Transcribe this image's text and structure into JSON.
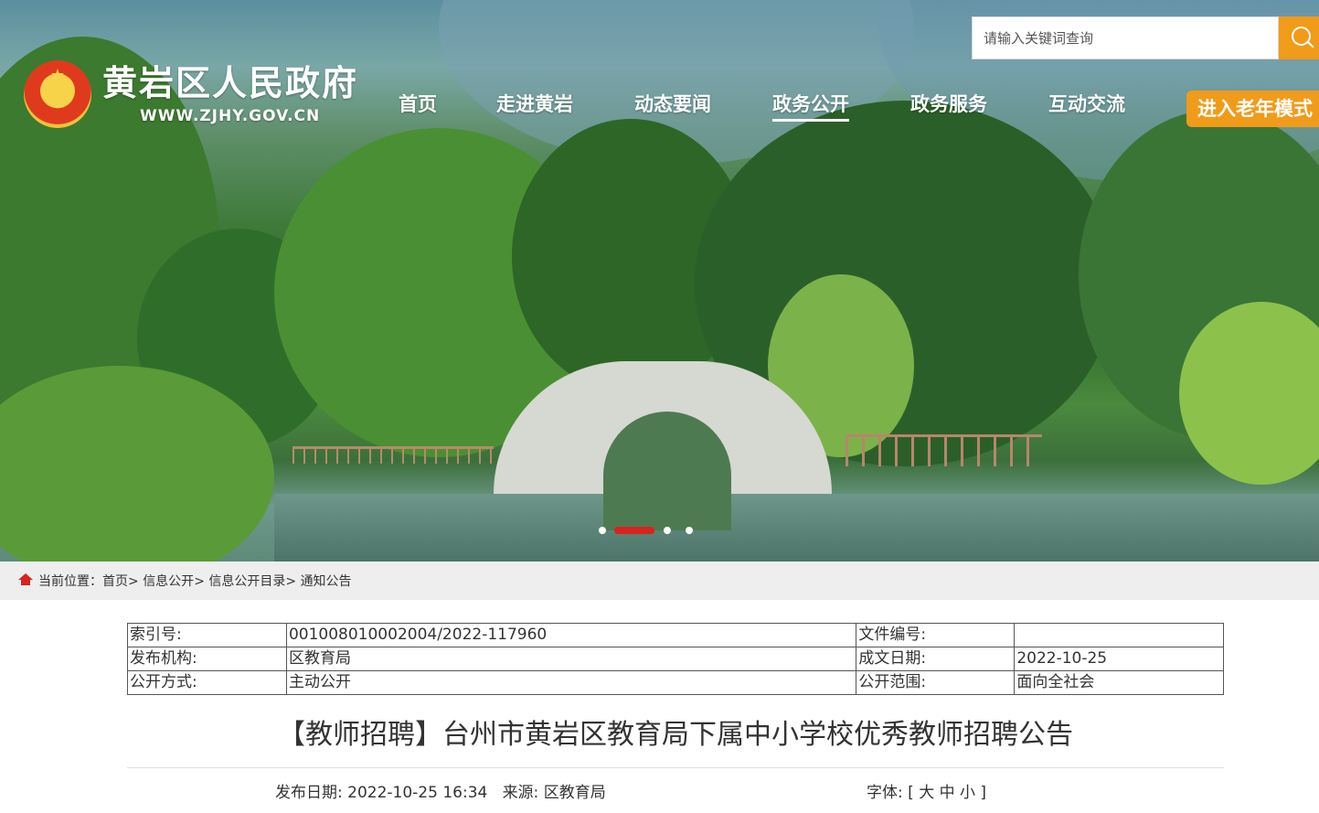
{
  "site": {
    "name": "黄岩区人民政府",
    "url": "WWW.ZJHY.GOV.CN"
  },
  "search": {
    "placeholder": "请输入关键词查询",
    "icon": "search-icon"
  },
  "nav": {
    "items": [
      {
        "label": "首页",
        "active": false
      },
      {
        "label": "走进黄岩",
        "active": false
      },
      {
        "label": "动态要闻",
        "active": false
      },
      {
        "label": "政务公开",
        "active": true
      },
      {
        "label": "政务服务",
        "active": false
      },
      {
        "label": "互动交流",
        "active": false
      }
    ],
    "elder_mode_label": "进入老年模式"
  },
  "slider": {
    "slide_count": 4,
    "active_index": 1
  },
  "breadcrumb": {
    "prefix": "当前位置：",
    "items": [
      "首页",
      "信息公开",
      "信息公开目录",
      "通知公告"
    ],
    "separator": ">"
  },
  "meta": {
    "rows": [
      {
        "k1": "索引号:",
        "v1": "001008010002004/2022-117960",
        "k2": "文件编号:",
        "v2": ""
      },
      {
        "k1": "发布机构:",
        "v1": "区教育局",
        "k2": "成文日期:",
        "v2": "2022-10-25"
      },
      {
        "k1": "公开方式:",
        "v1": "主动公开",
        "k2": "公开范围:",
        "v2": "面向全社会"
      }
    ]
  },
  "article": {
    "title": "【教师招聘】台州市黄岩区教育局下属中小学校优秀教师招聘公告",
    "publish_label": "发布日期: ",
    "publish_date": "2022-10-25 16:34",
    "source_label": "来源: ",
    "source": "区教育局",
    "font_label": "字体:",
    "font_open": "[",
    "font_large": "大",
    "font_medium": "中",
    "font_small": "小",
    "font_close": "]"
  },
  "colors": {
    "accent_orange": "#f19b1a",
    "slider_active_red": "#d8231f",
    "breadcrumb_bg": "#eeeeee"
  }
}
